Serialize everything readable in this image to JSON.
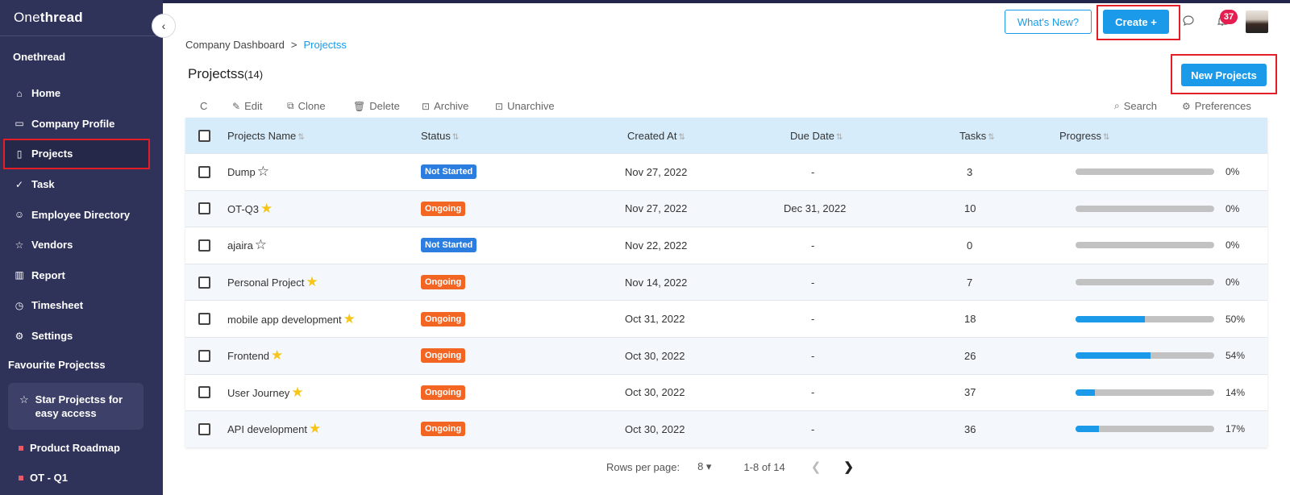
{
  "app": {
    "brand_prefix": "One",
    "brand_suffix": "thread",
    "workspace": "Onethread"
  },
  "sidebar": {
    "items": [
      {
        "label": "Home",
        "icon": "home-icon"
      },
      {
        "label": "Company Profile",
        "icon": "briefcase-icon"
      },
      {
        "label": "Projects",
        "icon": "document-icon",
        "active": true
      },
      {
        "label": "Task",
        "icon": "check-circle-icon"
      },
      {
        "label": "Employee Directory",
        "icon": "users-icon"
      },
      {
        "label": "Vendors",
        "icon": "star-icon"
      },
      {
        "label": "Report",
        "icon": "chart-icon"
      },
      {
        "label": "Timesheet",
        "icon": "clock-icon"
      },
      {
        "label": "Settings",
        "icon": "gear-icon"
      }
    ],
    "favourites_heading": "Favourite Projectss",
    "fav_card_text": "Star Projectss for easy access",
    "projects": [
      "Product Roadmap",
      "OT - Q1"
    ]
  },
  "header": {
    "whats_new": "What's New?",
    "create": "Create +",
    "notification_count": "37"
  },
  "breadcrumb": {
    "root": "Company Dashboard",
    "separator": ">",
    "current": "Projectss"
  },
  "page": {
    "title": "Projectss",
    "count": "(14)",
    "new_button": "New Projects"
  },
  "toolbar": {
    "refresh": "C",
    "edit": "Edit",
    "clone": "Clone",
    "delete": "Delete",
    "archive": "Archive",
    "unarchive": "Unarchive",
    "search": "Search",
    "preferences": "Preferences"
  },
  "table": {
    "headers": {
      "name": "Projects Name",
      "status": "Status",
      "created": "Created At",
      "due": "Due Date",
      "tasks": "Tasks",
      "progress": "Progress"
    },
    "rows": [
      {
        "name": "Dump",
        "starred": false,
        "status": "Not Started",
        "created": "Nov 27, 2022",
        "due": "-",
        "tasks": "3",
        "progress": 0,
        "progress_label": "0%"
      },
      {
        "name": "OT-Q3",
        "starred": true,
        "status": "Ongoing",
        "created": "Nov 27, 2022",
        "due": "Dec 31, 2022",
        "tasks": "10",
        "progress": 0,
        "progress_label": "0%"
      },
      {
        "name": "ajaira",
        "starred": false,
        "status": "Not Started",
        "created": "Nov 22, 2022",
        "due": "-",
        "tasks": "0",
        "progress": 0,
        "progress_label": "0%"
      },
      {
        "name": "Personal Project",
        "starred": true,
        "status": "Ongoing",
        "created": "Nov 14, 2022",
        "due": "-",
        "tasks": "7",
        "progress": 0,
        "progress_label": "0%"
      },
      {
        "name": "mobile app development",
        "starred": true,
        "status": "Ongoing",
        "created": "Oct 31, 2022",
        "due": "-",
        "tasks": "18",
        "progress": 50,
        "progress_label": "50%"
      },
      {
        "name": "Frontend",
        "starred": true,
        "status": "Ongoing",
        "created": "Oct 30, 2022",
        "due": "-",
        "tasks": "26",
        "progress": 54,
        "progress_label": "54%"
      },
      {
        "name": "User Journey",
        "starred": true,
        "status": "Ongoing",
        "created": "Oct 30, 2022",
        "due": "-",
        "tasks": "37",
        "progress": 14,
        "progress_label": "14%"
      },
      {
        "name": "API development",
        "starred": true,
        "status": "Ongoing",
        "created": "Oct 30, 2022",
        "due": "-",
        "tasks": "36",
        "progress": 17,
        "progress_label": "17%"
      }
    ]
  },
  "status_colors": {
    "Not Started": "#2b7de0",
    "Ongoing": "#f26522"
  },
  "pagination": {
    "rows_per_page_label": "Rows per page:",
    "rows_per_page": "8",
    "range": "1-8 of 14"
  }
}
